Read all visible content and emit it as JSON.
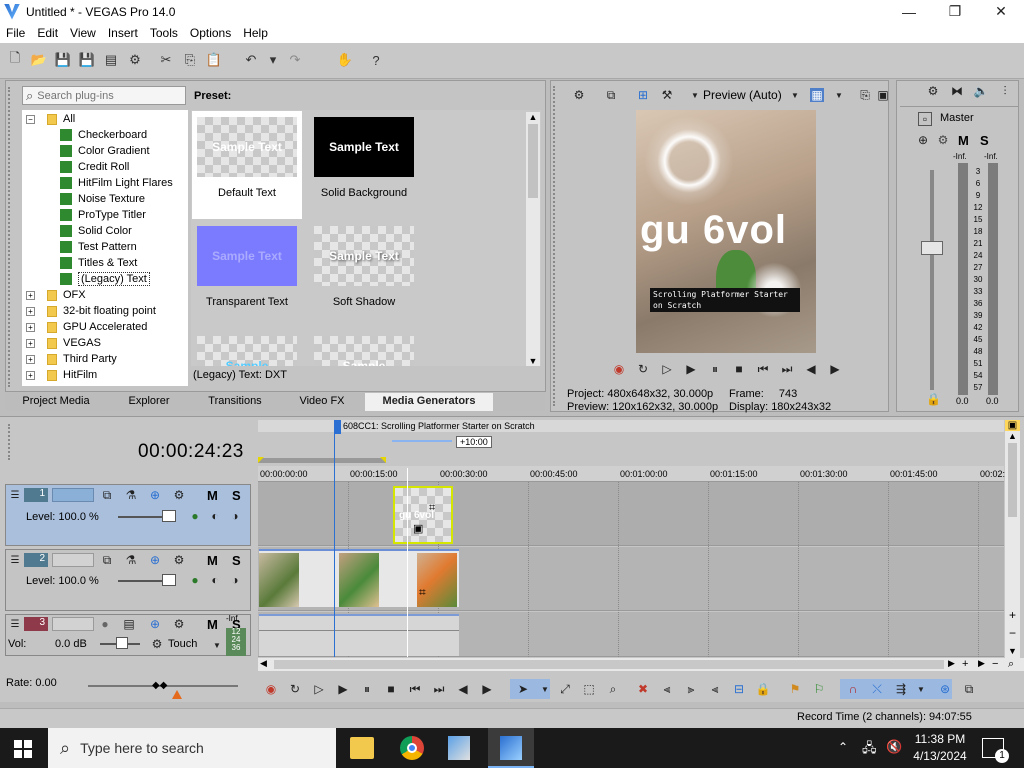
{
  "window": {
    "title": "Untitled * - VEGAS Pro 14.0"
  },
  "menu": [
    "File",
    "Edit",
    "View",
    "Insert",
    "Tools",
    "Options",
    "Help"
  ],
  "plugins": {
    "search_placeholder": "Search plug-ins",
    "preset_label": "Preset:",
    "tree": [
      "All",
      "Checkerboard",
      "Color Gradient",
      "Credit Roll",
      "HitFilm Light Flares",
      "Noise Texture",
      "ProType Titler",
      "Solid Color",
      "Test Pattern",
      "Titles & Text",
      "(Legacy) Text",
      "OFX",
      "32-bit floating point",
      "GPU Accelerated",
      "VEGAS",
      "Third Party",
      "HitFilm"
    ],
    "presets": [
      "Default Text",
      "Solid Background",
      "Transparent Text",
      "Soft Shadow"
    ],
    "sample_text": "Sample Text",
    "sample_short": "Sample",
    "status": "(Legacy) Text: DXT"
  },
  "tabs": [
    "Project Media",
    "Explorer",
    "Transitions",
    "Video FX",
    "Media Generators"
  ],
  "preview": {
    "mode": "Preview (Auto)",
    "overlay_big": "gu 6vol",
    "overlay_small": "Scrolling Platformer Starter on Scratch",
    "project_label": "Project:",
    "project_value": "480x648x32, 30.000p",
    "preview_label": "Preview:",
    "preview_value": "120x162x32, 30.000p",
    "frame_label": "Frame:",
    "frame_value": "743",
    "display_label": "Display:",
    "display_value": "180x243x32"
  },
  "master": {
    "title": "Master",
    "m": "M",
    "s": "S",
    "inf_l": "-Inf.",
    "inf_r": "-Inf.",
    "scale": [
      "3",
      "6",
      "9",
      "12",
      "15",
      "18",
      "21",
      "24",
      "27",
      "30",
      "33",
      "36",
      "39",
      "42",
      "45",
      "48",
      "51",
      "54",
      "57"
    ],
    "val_l": "0.0",
    "val_r": "0.0"
  },
  "timeline": {
    "timecode": "00:00:24:23",
    "region_label": "608CC1: Scrolling Platformer Starter on Scratch",
    "marker": "+10:00",
    "ruler": [
      "00:00:00:00",
      "00:00:15:00",
      "00:00:30:00",
      "00:00:45:00",
      "00:01:00:00",
      "00:01:15:00",
      "00:01:30:00",
      "00:01:45:00",
      "00:02:"
    ],
    "tracks": [
      {
        "num": "1",
        "level_label": "Level:",
        "level": "100.0 %"
      },
      {
        "num": "2",
        "level_label": "Level:",
        "level": "100.0 %"
      },
      {
        "num": "3",
        "level_label": "Vol:",
        "level": "0.0 dB",
        "mode": "Touch",
        "inf": "-Inf.",
        "meter": [
          "12",
          "24",
          "36"
        ]
      }
    ],
    "m": "M",
    "s": "S",
    "clip_text": "gu 6vol"
  },
  "rate": "Rate: 0.00",
  "status": "Record Time (2 channels): 94:07:55",
  "taskbar": {
    "search": "Type here to search",
    "time": "11:38 PM",
    "date": "4/13/2024",
    "notif": "1"
  }
}
